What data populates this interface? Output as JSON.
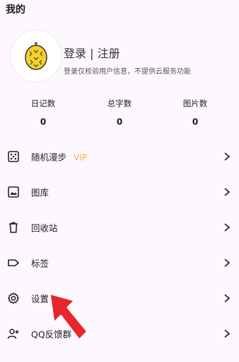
{
  "page_title": "我的",
  "profile": {
    "login_label": "登录 | 注册",
    "hint": "登录仅校验用户信息，不提供云服务功能",
    "avatar_icon": "durian-avatar-icon"
  },
  "stats": [
    {
      "label": "日记数",
      "value": "0"
    },
    {
      "label": "总字数",
      "value": "0"
    },
    {
      "label": "图片数",
      "value": "0"
    }
  ],
  "menu": [
    {
      "label": "随机漫步",
      "badge": "VIP",
      "icon": "dice-icon"
    },
    {
      "label": "图库",
      "badge": "",
      "icon": "image-icon"
    },
    {
      "label": "回收站",
      "badge": "",
      "icon": "trash-icon"
    },
    {
      "label": "标签",
      "badge": "",
      "icon": "tag-icon"
    },
    {
      "label": "设置",
      "badge": "",
      "icon": "gear-icon"
    },
    {
      "label": "QQ反馈群",
      "badge": "",
      "icon": "add-user-icon"
    }
  ],
  "colors": {
    "vip": "#e8b53a",
    "accent_arrow": "#e8262d",
    "avatar_fruit": "#f6d12a"
  }
}
